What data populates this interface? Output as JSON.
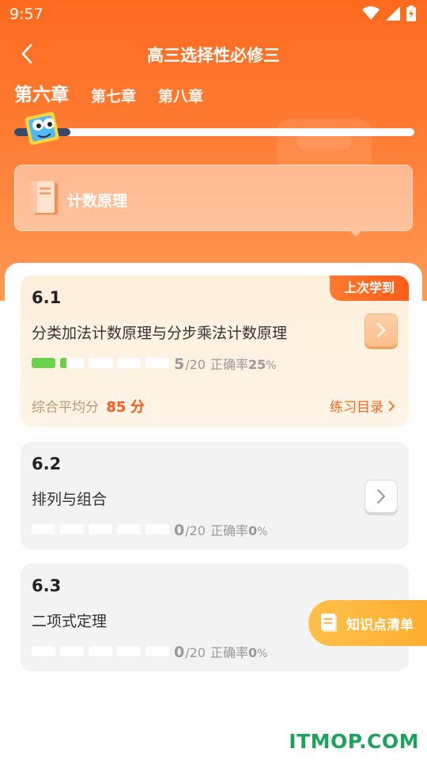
{
  "status": {
    "time": "9:57"
  },
  "header": {
    "title": "高三选择性必修三"
  },
  "chapters": [
    {
      "label": "第六章",
      "active": true
    },
    {
      "label": "第七章",
      "active": false
    },
    {
      "label": "第八章",
      "active": false
    }
  ],
  "chapter_progress": 0.14,
  "section": {
    "title": "计数原理"
  },
  "lessons": [
    {
      "number": "6.1",
      "title": "分类加法计数原理与分步乘法计数原理",
      "done": "5",
      "total": "/20",
      "rate_label": "正确率",
      "rate": "25",
      "rate_unit": "%",
      "current": true,
      "badge": "上次学到",
      "avg_label": "综合平均分",
      "avg_score": "85",
      "avg_unit": "分",
      "practice_label": "练习目录",
      "bar_fill": [
        1,
        0.25,
        0,
        0,
        0
      ]
    },
    {
      "number": "6.2",
      "title": "排列与组合",
      "done": "0",
      "total": "/20",
      "rate_label": "正确率",
      "rate": "0",
      "rate_unit": "%",
      "current": false,
      "bar_fill": [
        0,
        0,
        0,
        0,
        0
      ]
    },
    {
      "number": "6.3",
      "title": "二项式定理",
      "done": "0",
      "total": "/20",
      "rate_label": "正确率",
      "rate": "0",
      "rate_unit": "%",
      "current": false,
      "bar_fill": [
        0,
        0,
        0,
        0,
        0
      ]
    }
  ],
  "knowledge_button": {
    "label": "知识点清单"
  },
  "watermark": "ITMOP.COM",
  "colors": {
    "accent": "#ff6a1e",
    "progress_green": "#6ad24a",
    "fab": "#ffb43a"
  },
  "icons": {
    "back": "chevron-left-icon",
    "arrow": "chevron-right-icon",
    "book": "book-icon"
  }
}
